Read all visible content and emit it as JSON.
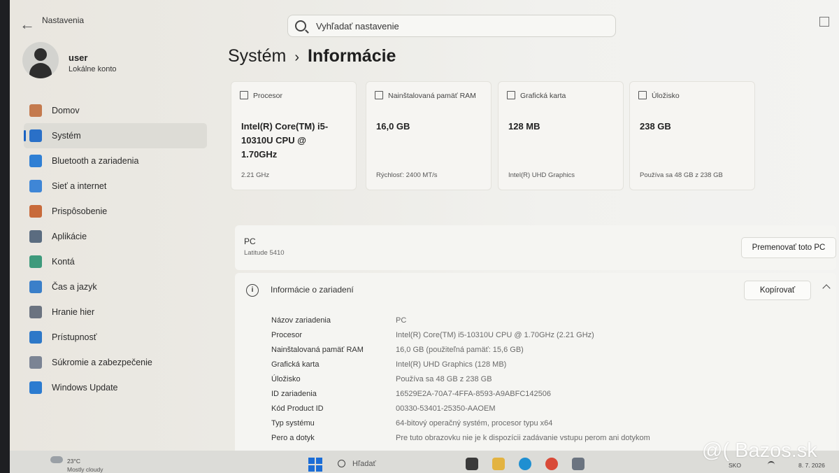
{
  "app": {
    "title": "Nastavenia"
  },
  "search": {
    "placeholder": "Vyhľadať nastavenie"
  },
  "profile": {
    "name": "user",
    "account_type": "Lokálne konto"
  },
  "sidebar": {
    "items": [
      {
        "label": "Domov",
        "icon": "home-icon",
        "color": "#c47a4e"
      },
      {
        "label": "Systém",
        "icon": "system-icon",
        "color": "#2a70c8",
        "active": true
      },
      {
        "label": "Bluetooth a zariadenia",
        "icon": "bluetooth-icon",
        "color": "#2f7fd4"
      },
      {
        "label": "Sieť a internet",
        "icon": "wifi-icon",
        "color": "#3f86d6"
      },
      {
        "label": "Prispôsobenie",
        "icon": "brush-icon",
        "color": "#c86a3a"
      },
      {
        "label": "Aplikácie",
        "icon": "apps-icon",
        "color": "#5b6c80"
      },
      {
        "label": "Kontá",
        "icon": "accounts-icon",
        "color": "#3e9a7c"
      },
      {
        "label": "Čas a jazyk",
        "icon": "globe-clock-icon",
        "color": "#3a7fc9"
      },
      {
        "label": "Hranie hier",
        "icon": "gamepad-icon",
        "color": "#6b7380"
      },
      {
        "label": "Prístupnosť",
        "icon": "accessibility-icon",
        "color": "#2d78c8"
      },
      {
        "label": "Súkromie a zabezpečenie",
        "icon": "shield-icon",
        "color": "#7b8494"
      },
      {
        "label": "Windows Update",
        "icon": "update-icon",
        "color": "#2b7bd0"
      }
    ]
  },
  "breadcrumb": {
    "parent": "Systém",
    "separator": "›",
    "current": "Informácie"
  },
  "cards": [
    {
      "header": "Procesor",
      "icon": "cpu-icon",
      "value": "Intel(R) Core(TM) i5-10310U CPU @ 1.70GHz",
      "footer": "2.21 GHz"
    },
    {
      "header": "Nainštalovaná pamäť RAM",
      "icon": "ram-icon",
      "value": "16,0 GB",
      "footer": "Rýchlosť: 2400 MT/s"
    },
    {
      "header": "Grafická karta",
      "icon": "gpu-icon",
      "value": "128 MB",
      "footer": "Intel(R) UHD Graphics"
    },
    {
      "header": "Úložisko",
      "icon": "storage-icon",
      "value": "238 GB",
      "footer": "Používa sa 48 GB z 238 GB"
    }
  ],
  "pc": {
    "name": "PC",
    "model": "Latitude 5410",
    "rename_label": "Premenovať toto PC"
  },
  "device_info": {
    "title": "Informácie o zariadení",
    "copy_label": "Kopírovať",
    "rows": [
      {
        "label": "Názov zariadenia",
        "value": "PC"
      },
      {
        "label": "Procesor",
        "value": "Intel(R) Core(TM) i5-10310U CPU @ 1.70GHz (2.21 GHz)"
      },
      {
        "label": "Nainštalovaná pamäť RAM",
        "value": "16,0 GB (použiteľná pamäť: 15,6 GB)"
      },
      {
        "label": "Grafická karta",
        "value": "Intel(R) UHD Graphics (128 MB)"
      },
      {
        "label": "Úložisko",
        "value": "Používa sa 48 GB z 238 GB"
      },
      {
        "label": "ID zariadenia",
        "value": "16529E2A-70A7-4FFA-8593-A9ABFC142506"
      },
      {
        "label": "Kód Product ID",
        "value": "00330-53401-25350-AAOEM"
      },
      {
        "label": "Typ systému",
        "value": "64-bitový operačný systém, procesor typu x64"
      },
      {
        "label": "Pero a dotyk",
        "value": "Pre tuto obrazovku nie je k dispozícii zadávanie vstupu perom ani dotykom"
      }
    ]
  },
  "taskbar": {
    "weather_temp": "23°C",
    "weather_desc": "Mostly cloudy",
    "search_label": "Hľadať",
    "lang": "SKO",
    "date": "8. 7. 2026",
    "apps": [
      {
        "icon": "task-view-icon",
        "color": "#3a3a3a"
      },
      {
        "icon": "file-explorer-icon",
        "color": "#e3b341"
      },
      {
        "icon": "edge-icon",
        "color": "#1f8fd1"
      },
      {
        "icon": "chrome-icon",
        "color": "#d94a38"
      },
      {
        "icon": "settings-icon",
        "color": "#6b7480"
      }
    ]
  },
  "watermark": {
    "text": "@( Bazos.sk"
  }
}
